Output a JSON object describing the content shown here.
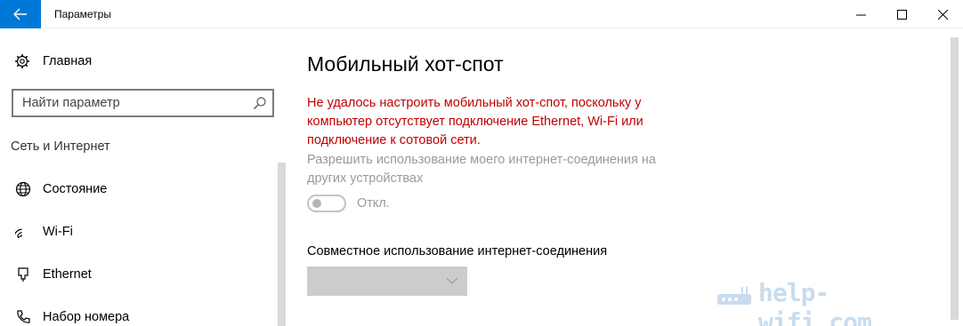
{
  "window": {
    "title": "Параметры",
    "accent_color": "#0078d7",
    "back_icon": "arrow-left-icon",
    "minimize_icon": "minimize-icon",
    "maximize_icon": "maximize-icon",
    "close_icon": "close-icon"
  },
  "sidebar": {
    "home": {
      "label": "Главная",
      "icon": "gear-icon"
    },
    "search": {
      "placeholder": "Найти параметр",
      "icon": "search-icon"
    },
    "section_title": "Сеть и Интернет",
    "items": [
      {
        "label": "Состояние",
        "icon": "globe-icon"
      },
      {
        "label": "Wi-Fi",
        "icon": "wifi-icon"
      },
      {
        "label": "Ethernet",
        "icon": "ethernet-icon"
      },
      {
        "label": "Набор номера",
        "icon": "phone-icon"
      }
    ]
  },
  "main": {
    "page_title": "Мобильный хот-спот",
    "error_message": "Не удалось настроить мобильный хот-спот, поскольку у компьютер отсутствует подключение Ethernet, Wi-Fi или подключение к сотовой сети.",
    "error_color": "#c00000",
    "allow_sharing_label": "Разрешить использование моего интернет-соединения на других устройствах",
    "toggle_state": "Откл.",
    "toggle_on": false,
    "share_connection_label": "Совместное использование интернет-соединения",
    "share_connection_value": ""
  },
  "watermark": {
    "text": "help-wifi.com",
    "icon": "router-icon"
  }
}
